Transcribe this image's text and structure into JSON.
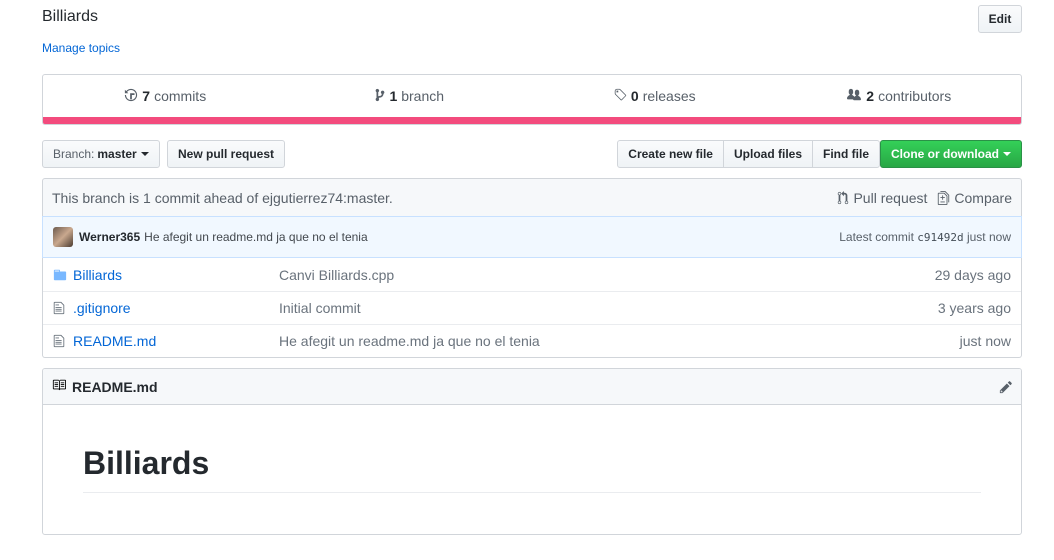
{
  "repo": {
    "description": "Billiards",
    "manage_topics": "Manage topics",
    "edit_label": "Edit"
  },
  "summary": {
    "commits_count": "7",
    "commits_label": "commits",
    "branch_count": "1",
    "branch_label": "branch",
    "releases_count": "0",
    "releases_label": "releases",
    "contributors_count": "2",
    "contributors_label": "contributors",
    "language_color": "#f34b7d"
  },
  "toolbar": {
    "branch_prefix": "Branch:",
    "branch_name": "master",
    "new_pull_request": "New pull request",
    "create_new_file": "Create new file",
    "upload_files": "Upload files",
    "find_file": "Find file",
    "clone_or_download": "Clone or download"
  },
  "branch_status": {
    "message": "This branch is 1 commit ahead of ejgutierrez74:master.",
    "pull_request": "Pull request",
    "compare": "Compare"
  },
  "latest_commit": {
    "author": "Werner365",
    "message": "He afegit un readme.md ja que no el tenia",
    "label": "Latest commit",
    "sha": "c91492d",
    "age": "just now"
  },
  "files": [
    {
      "type": "folder-icon",
      "name": "Billiards",
      "message": "Canvi Billiards.cpp",
      "age": "29 days ago"
    },
    {
      "type": "file-icon",
      "name": ".gitignore",
      "message": "Initial commit",
      "age": "3 years ago"
    },
    {
      "type": "file-icon",
      "name": "README.md",
      "message": "He afegit un readme.md ja que no el tenia",
      "age": "just now"
    }
  ],
  "readme": {
    "filename": "README.md",
    "heading": "Billiards"
  }
}
